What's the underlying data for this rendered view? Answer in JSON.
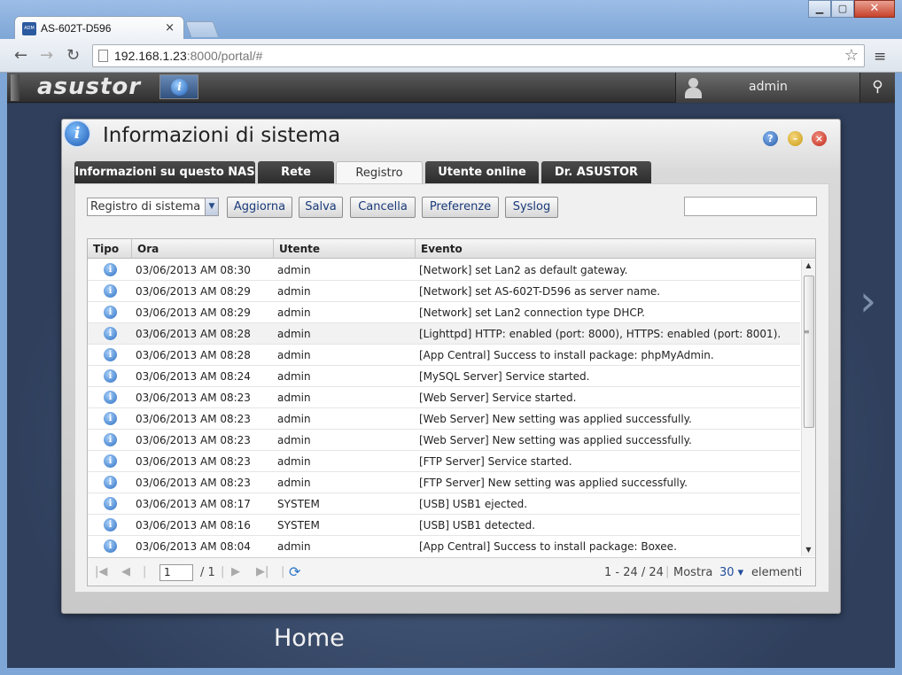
{
  "browser": {
    "tab_title": "AS-602T-D596",
    "url_host": "192.168.1.23",
    "url_rest": ":8000/portal/#"
  },
  "topbar": {
    "logo": "asustor",
    "username": "admin"
  },
  "dialog": {
    "title": "Informazioni di sistema",
    "tabs": [
      {
        "label": "Informazioni su questo NAS"
      },
      {
        "label": "Rete"
      },
      {
        "label": "Registro"
      },
      {
        "label": "Utente online"
      },
      {
        "label": "Dr. ASUSTOR"
      }
    ],
    "active_tab": "Registro",
    "log_select": "Registro di sistema",
    "buttons": {
      "refresh": "Aggiorna",
      "save": "Salva",
      "delete": "Cancella",
      "preferences": "Preferenze",
      "syslog": "Syslog"
    },
    "search_value": "",
    "table": {
      "columns": [
        "Tipo",
        "Ora",
        "Utente",
        "Evento"
      ],
      "rows": [
        {
          "type": "info",
          "time": "03/06/2013 AM 08:30",
          "user": "admin",
          "event": "[Network] set Lan2 as default gateway."
        },
        {
          "type": "info",
          "time": "03/06/2013 AM 08:29",
          "user": "admin",
          "event": "[Network] set AS-602T-D596 as server name."
        },
        {
          "type": "info",
          "time": "03/06/2013 AM 08:29",
          "user": "admin",
          "event": "[Network] set Lan2 connection type DHCP."
        },
        {
          "type": "info",
          "time": "03/06/2013 AM 08:28",
          "user": "admin",
          "event": "[Lighttpd] HTTP: enabled (port: 8000), HTTPS: enabled (port: 8001)."
        },
        {
          "type": "info",
          "time": "03/06/2013 AM 08:28",
          "user": "admin",
          "event": "[App Central] Success to install package: phpMyAdmin."
        },
        {
          "type": "info",
          "time": "03/06/2013 AM 08:24",
          "user": "admin",
          "event": "[MySQL Server] Service started."
        },
        {
          "type": "info",
          "time": "03/06/2013 AM 08:23",
          "user": "admin",
          "event": "[Web Server] Service started."
        },
        {
          "type": "info",
          "time": "03/06/2013 AM 08:23",
          "user": "admin",
          "event": "[Web Server] New setting was applied successfully."
        },
        {
          "type": "info",
          "time": "03/06/2013 AM 08:23",
          "user": "admin",
          "event": "[Web Server] New setting was applied successfully."
        },
        {
          "type": "info",
          "time": "03/06/2013 AM 08:23",
          "user": "admin",
          "event": "[FTP Server] Service started."
        },
        {
          "type": "info",
          "time": "03/06/2013 AM 08:23",
          "user": "admin",
          "event": "[FTP Server] New setting was applied successfully."
        },
        {
          "type": "info",
          "time": "03/06/2013 AM 08:17",
          "user": "SYSTEM",
          "event": "[USB] USB1 ejected."
        },
        {
          "type": "info",
          "time": "03/06/2013 AM 08:16",
          "user": "SYSTEM",
          "event": "[USB] USB1 detected."
        },
        {
          "type": "info",
          "time": "03/06/2013 AM 08:04",
          "user": "admin",
          "event": "[App Central] Success to install package: Boxee."
        }
      ]
    },
    "pager": {
      "page": "1",
      "total_pages": "/ 1",
      "range": "1 - 24 / 24",
      "show_label": "Mostra",
      "show_value": "30",
      "items_label": "elementi"
    }
  },
  "desktop": {
    "home_label": "Home"
  },
  "icons": [
    "back-icon",
    "forward-icon",
    "reload-icon",
    "star-icon",
    "menu-icon",
    "user-icon",
    "search-icon",
    "info-icon",
    "help-icon",
    "minimize-icon",
    "close-icon",
    "first-page-icon",
    "prev-page-icon",
    "next-page-icon",
    "last-page-icon",
    "refresh-icon",
    "next-arrow-icon"
  ],
  "colors": {
    "accent": "#1e4c9a",
    "tab_dark": "#333333",
    "desktop_bg": "#2f3f5c"
  }
}
